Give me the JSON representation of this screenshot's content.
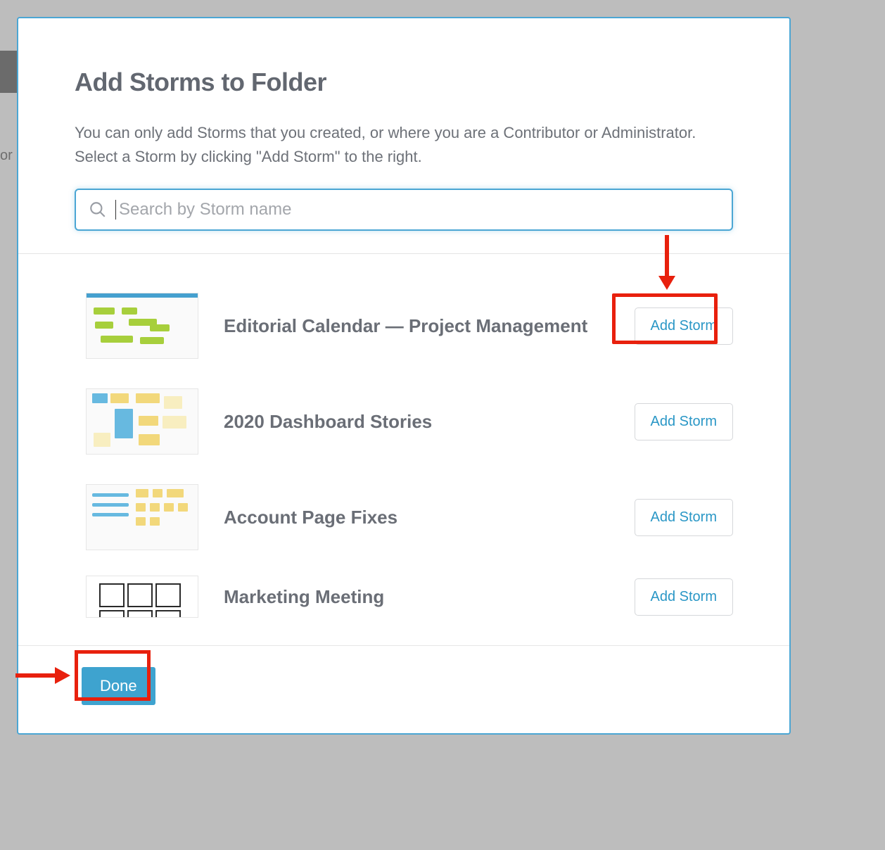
{
  "modal": {
    "title": "Add Storms to Folder",
    "description": "You can only add Storms that you created, or where you are a Contributor or Administrator. Select a Storm by clicking \"Add Storm\" to the right.",
    "search_placeholder": "Search by Storm name",
    "done_label": "Done"
  },
  "storms": [
    {
      "name": "Editorial Calendar — Project Management",
      "action_label": "Add Storm"
    },
    {
      "name": "2020 Dashboard Stories",
      "action_label": "Add Storm"
    },
    {
      "name": "Account Page Fixes",
      "action_label": "Add Storm"
    },
    {
      "name": "Marketing Meeting",
      "action_label": "Add Storm"
    }
  ],
  "annotations": {
    "arrow_to_add_storm": true,
    "arrow_to_done": true,
    "highlight_color": "#e8200d"
  }
}
